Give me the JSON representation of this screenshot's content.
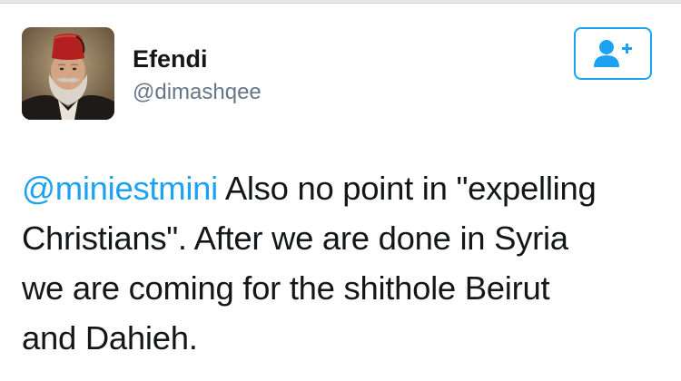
{
  "user": {
    "display_name": "Efendi",
    "handle": "@dimashqee"
  },
  "avatar": {
    "icon": "portrait-fez-man"
  },
  "follow_button": {
    "icon": "add-user-icon",
    "color": "#1da1f2"
  },
  "tweet": {
    "mention": "@miniestmini",
    "line1": " Also no point in \"expelling",
    "line2": "Christians\". After we are done in Syria",
    "line3": "we are coming for the shithole Beirut",
    "line4": "and Dahieh."
  },
  "colors": {
    "accent": "#1da1f2",
    "text": "#14171a",
    "secondary": "#657786"
  }
}
